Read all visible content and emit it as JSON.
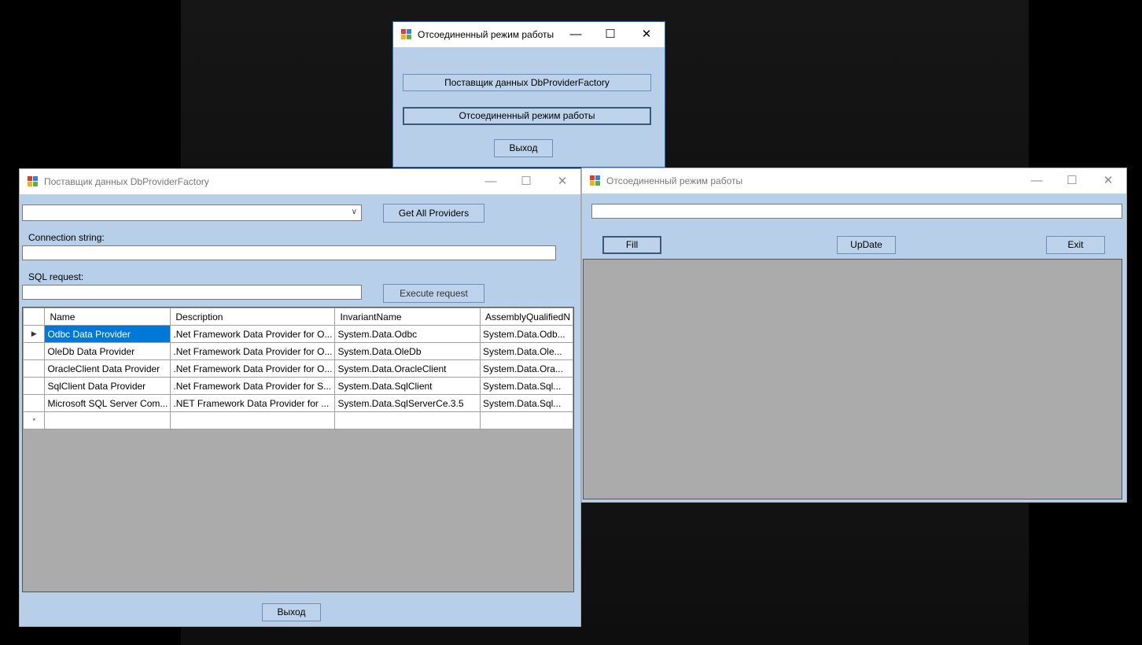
{
  "main_window": {
    "title": "Отсоединенный режим работы",
    "buttons": {
      "provider_factory": "Поставщик данных DbProviderFactory",
      "disconnected_mode": "Отсоединенный режим работы",
      "exit": "Выход"
    }
  },
  "provider_window": {
    "title": "Поставщик данных DbProviderFactory",
    "provider_select": {
      "value": ""
    },
    "get_all_providers_label": "Get All Providers",
    "connection_string_label": "Connection string:",
    "connection_string_value": "",
    "sql_request_label": "SQL request:",
    "sql_request_value": "",
    "execute_request_label": "Execute request",
    "grid": {
      "columns": [
        "Name",
        "Description",
        "InvariantName",
        "AssemblyQualifiedN"
      ],
      "rows": [
        [
          "Odbc Data Provider",
          ".Net Framework Data Provider for O...",
          "System.Data.Odbc",
          "System.Data.Odb..."
        ],
        [
          "OleDb Data Provider",
          ".Net Framework Data Provider for O...",
          "System.Data.OleDb",
          "System.Data.Ole..."
        ],
        [
          "OracleClient Data Provider",
          ".Net Framework Data Provider for O...",
          "System.Data.OracleClient",
          "System.Data.Ora..."
        ],
        [
          "SqlClient Data Provider",
          ".Net Framework Data Provider for S...",
          "System.Data.SqlClient",
          "System.Data.Sql..."
        ],
        [
          "Microsoft SQL Server Com...",
          ".NET Framework Data Provider for ...",
          "System.Data.SqlServerCe.3.5",
          "System.Data.Sql..."
        ]
      ],
      "current_row_marker": "▶",
      "new_row_marker": "*"
    },
    "exit_label": "Выход"
  },
  "disconnected_window": {
    "title": "Отсоединенный режим работы",
    "input_value": "",
    "fill_label": "Fill",
    "update_label": "UpDate",
    "exit_label": "Exit"
  },
  "caption_glyphs": {
    "minimize": "—",
    "maximize": "☐",
    "close": "✕"
  },
  "colors": {
    "form_background": "#b7cfe9",
    "grid_background": "#ababab",
    "selection": "#0078d7",
    "active_border": "#1f6fd0"
  }
}
